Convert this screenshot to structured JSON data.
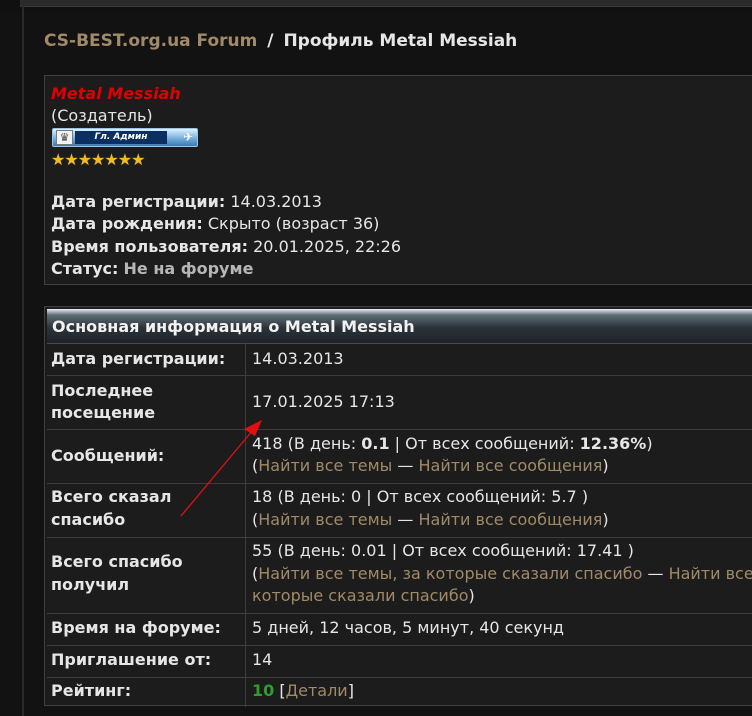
{
  "breadcrumb": {
    "forum_link": "CS-BEST.org.ua Forum",
    "separator": "/",
    "current": "Профиль Metal Messiah"
  },
  "profile": {
    "username": "Metal Messiah",
    "title": "(Создатель)",
    "rank_label": "Гл. Админ",
    "stars": 7,
    "lines": [
      {
        "label": "Дата регистрации:",
        "value": "14.03.2013"
      },
      {
        "label": "Дата рождения:",
        "value": "Скрыто (возраст 36)"
      },
      {
        "label": "Время пользователя:",
        "value": "20.01.2025, 22:26"
      },
      {
        "label": "Статус:",
        "value": "Не на форуме"
      }
    ]
  },
  "info_table": {
    "header": "Основная информация о Metal Messiah",
    "reg": {
      "label": "Дата регистрации:",
      "value": "14.03.2013"
    },
    "last_visit": {
      "label_1": "Последнее",
      "label_2": "посещение",
      "value": "17.01.2025 17:13"
    },
    "posts": {
      "label": "Сообщений:",
      "count": "418",
      "per_day_prefix": "(В день:",
      "per_day": "0.1",
      "of_total_prefix": "| От всех сообщений:",
      "of_total": "12.36%",
      "close": ")",
      "open_paren": "(",
      "link_topics": "Найти все темы",
      "dash": "—",
      "link_posts": "Найти все сообщения",
      "close_paren": ")"
    },
    "thanks_given": {
      "label_1": "Всего сказал",
      "label_2": "спасибо",
      "line1": "18 (В день: 0 | От всех сообщений: 5.7 )",
      "open_paren": "(",
      "link_topics": "Найти все темы",
      "dash": "—",
      "link_posts": "Найти все сообщения",
      "close_paren": ")"
    },
    "thanks_received": {
      "label_1": "Всего спасибо",
      "label_2": "получил",
      "line1": "55 (В день: 0.01 | От всех сообщений: 17.41 )",
      "open_paren": "(",
      "link_topics": "Найти все темы, за которые сказали спасибо",
      "dash": "—",
      "link_posts_part1": "Найти все",
      "link_posts_part2": "которые сказали спасибо",
      "close_paren": ")"
    },
    "forum_time": {
      "label": "Время на форуме:",
      "value": "5 дней, 12 часов, 5 минут, 40 секунд"
    },
    "invited_by": {
      "label": "Приглашение от:",
      "value": "14"
    },
    "rating": {
      "label": "Рейтинг:",
      "value": "10",
      "open_bracket": "[",
      "details_link": "Детали",
      "close_bracket": "]"
    }
  },
  "annotation": {
    "color": "#e01010"
  }
}
